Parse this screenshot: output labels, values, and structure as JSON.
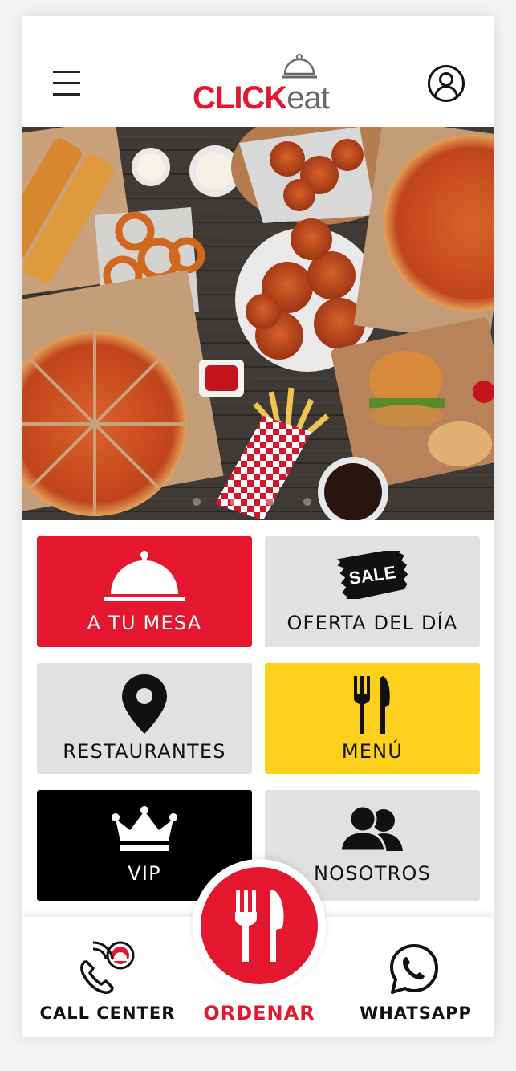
{
  "header": {
    "logo_part1": "CLICK",
    "logo_part2": "eat",
    "menu_icon": "hamburger-icon",
    "profile_icon": "user-circle-icon"
  },
  "banner": {
    "image": "food-spread-photo",
    "slide_count": 4
  },
  "tiles": [
    {
      "label": "A TU MESA",
      "icon": "cloche-icon",
      "bg": "#e4172e",
      "fg": "#ffffff"
    },
    {
      "label": "OFERTA DEL DÍA",
      "icon": "sale-tag-icon",
      "badge": "SALE",
      "bg": "#e1e1e1",
      "fg": "#111111"
    },
    {
      "label": "RESTAURANTES",
      "icon": "location-pin-icon",
      "bg": "#e1e1e1",
      "fg": "#111111"
    },
    {
      "label": "MENÚ",
      "icon": "fork-knife-icon",
      "bg": "#fcd01c",
      "fg": "#111111"
    },
    {
      "label": "VIP",
      "icon": "crown-icon",
      "bg": "#000000",
      "fg": "#ffffff"
    },
    {
      "label": "NOSOTROS",
      "icon": "users-icon",
      "bg": "#e1e1e1",
      "fg": "#111111"
    }
  ],
  "bottom_nav": {
    "call_center": "CALL CENTER",
    "ordenar": "ORDENAR",
    "whatsapp": "WHATSAPP"
  },
  "colors": {
    "brand_red": "#e4172e",
    "brand_yellow": "#fcd01c",
    "tile_gray": "#e1e1e1"
  }
}
